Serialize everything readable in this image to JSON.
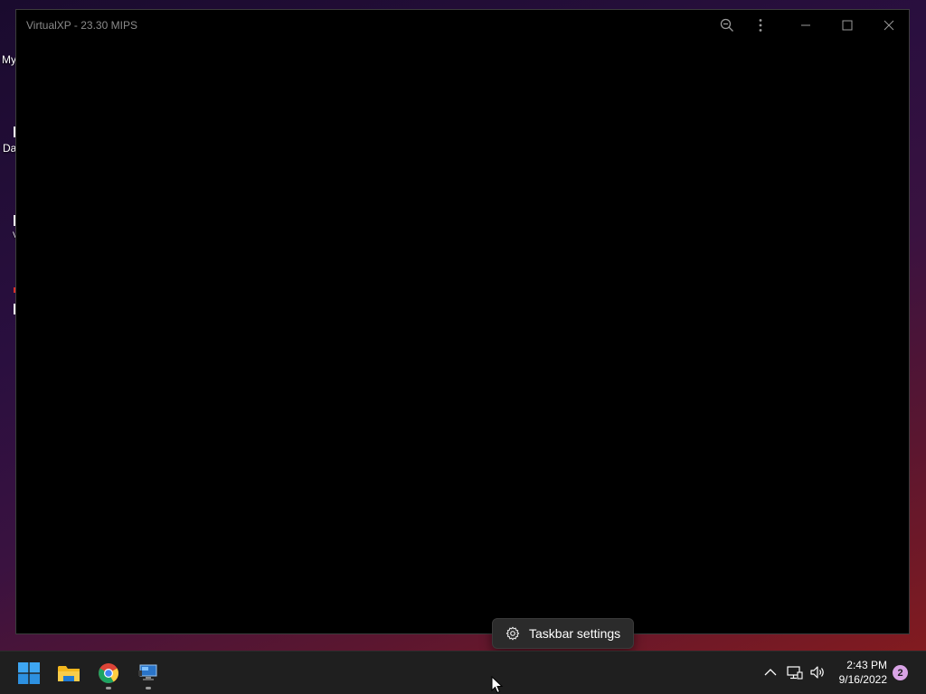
{
  "window": {
    "title": "VirtualXP - 23.30 MIPS",
    "buttons": [
      "zoom-out-icon",
      "more-vert-icon",
      "minimize-icon",
      "maximize-icon",
      "close-icon"
    ]
  },
  "desktop": {
    "labels": [
      "My",
      "Da",
      "V"
    ]
  },
  "context_menu": {
    "item_label": "Taskbar settings",
    "icon": "gear-icon"
  },
  "taskbar": {
    "apps": [
      {
        "name": "start",
        "icon": "windows-logo-icon"
      },
      {
        "name": "file-explorer",
        "icon": "folder-icon"
      },
      {
        "name": "chrome",
        "icon": "chrome-icon"
      },
      {
        "name": "virtualxp",
        "icon": "monitor-icon"
      }
    ],
    "tray": {
      "icons": [
        "chevron-up-icon",
        "network-icon",
        "volume-icon"
      ],
      "time": "2:43 PM",
      "date": "9/16/2022",
      "notification_count": "2"
    }
  }
}
